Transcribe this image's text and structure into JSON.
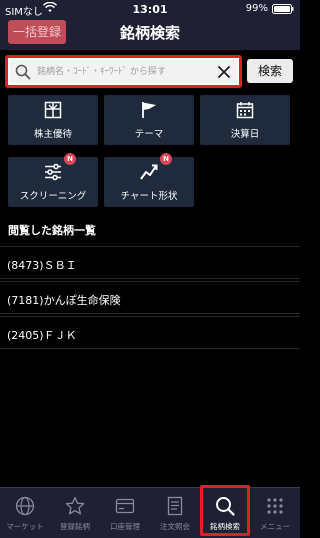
{
  "status_bar": {
    "carrier": "SIMなし",
    "time": "13:01",
    "battery": "99%"
  },
  "header": {
    "bulk_register": "一括登録",
    "title": "銘柄検索"
  },
  "search": {
    "placeholder": "銘柄名・ｺｰﾄﾞ・ｷｰﾜｰﾄﾞ から探す",
    "button": "検索"
  },
  "tiles": [
    {
      "label": "株主優待",
      "icon": "gift-icon",
      "badge": ""
    },
    {
      "label": "テーマ",
      "icon": "flag-icon",
      "badge": ""
    },
    {
      "label": "決算日",
      "icon": "calendar-icon",
      "badge": ""
    },
    {
      "label": "スクリーニング",
      "icon": "sliders-icon",
      "badge": "N"
    },
    {
      "label": "チャート形状",
      "icon": "chart-trend-icon",
      "badge": "N"
    }
  ],
  "history": {
    "heading": "閲覧した銘柄一覧",
    "items": [
      "(8473)ＳＢＩ",
      "(7181)かんぽ生命保険",
      "(2405)ＦＪＫ"
    ]
  },
  "tabbar": {
    "items": [
      {
        "label": "マーケット",
        "icon": "globe-icon"
      },
      {
        "label": "登録銘柄",
        "icon": "star-icon"
      },
      {
        "label": "口座管理",
        "icon": "wallet-icon"
      },
      {
        "label": "注文照会",
        "icon": "document-icon"
      },
      {
        "label": "銘柄検索",
        "icon": "search-icon"
      },
      {
        "label": "メニュー",
        "icon": "grid-menu-icon"
      }
    ],
    "active_index": 4
  },
  "colors": {
    "header_bg": "#1f2033",
    "tile_bg": "#1f2a3d",
    "highlight": "#e41e22",
    "bulk_button": "#bf4d57",
    "badge": "#d9475a"
  }
}
